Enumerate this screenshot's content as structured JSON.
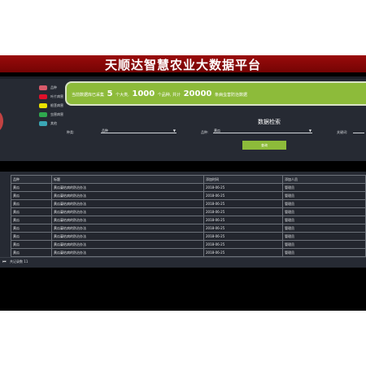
{
  "header": {
    "title": "天顺达智慧农业大数据平台"
  },
  "legend": [
    {
      "label": "品种",
      "color": "#d85a6a"
    },
    {
      "label": "叶片病害",
      "color": "#e0102a"
    },
    {
      "label": "根茎病害",
      "color": "#e8e100"
    },
    {
      "label": "虫害病害",
      "color": "#2fa84e"
    },
    {
      "label": "其他",
      "color": "#3aa6b4"
    }
  ],
  "stats": {
    "prefix": "当前数据库已采集",
    "categories": "5",
    "mid1": "个大类,",
    "varieties": "1000",
    "mid2": "个品种, 共计",
    "records": "20000",
    "suffix": "条病虫害防治数据"
  },
  "query": {
    "title": "数据检索",
    "type_label": "种类:",
    "type_value": "品种",
    "variety_label": "品种:",
    "variety_value": "黄瓜",
    "keyword_label": "关键词:",
    "button_label": "查询"
  },
  "table": {
    "columns": [
      "品种",
      "标题",
      "添加时间",
      "添加人员"
    ],
    "rows": [
      [
        "黄瓜",
        "黄瓜蔓枯病的防治办法",
        "2018-06-25",
        "管理员"
      ],
      [
        "黄瓜",
        "黄瓜蔓枯病的防治办法",
        "2018-06-25",
        "管理员"
      ],
      [
        "黄瓜",
        "黄瓜蔓枯病的防治办法",
        "2018-06-25",
        "管理员"
      ],
      [
        "黄瓜",
        "黄瓜蔓枯病的防治办法",
        "2018-06-25",
        "管理员"
      ],
      [
        "黄瓜",
        "黄瓜蔓枯病的防治办法",
        "2018-06-25",
        "管理员"
      ],
      [
        "黄瓜",
        "黄瓜蔓枯病的防治办法",
        "2018-06-25",
        "管理员"
      ],
      [
        "黄瓜",
        "黄瓜蔓枯病的防治办法",
        "2018-06-25",
        "管理员"
      ],
      [
        "黄瓜",
        "黄瓜蔓枯病的防治办法",
        "2018-06-25",
        "管理员"
      ],
      [
        "黄瓜",
        "黄瓜蔓枯病的防治办法",
        "2018-06-25",
        "管理员"
      ],
      [
        "黄瓜",
        "黄瓜蔓枯病的防治办法",
        "2018-06-25",
        "管理员"
      ]
    ]
  },
  "pager": {
    "icon": "first-page-icon",
    "text": "共记录数 11"
  }
}
